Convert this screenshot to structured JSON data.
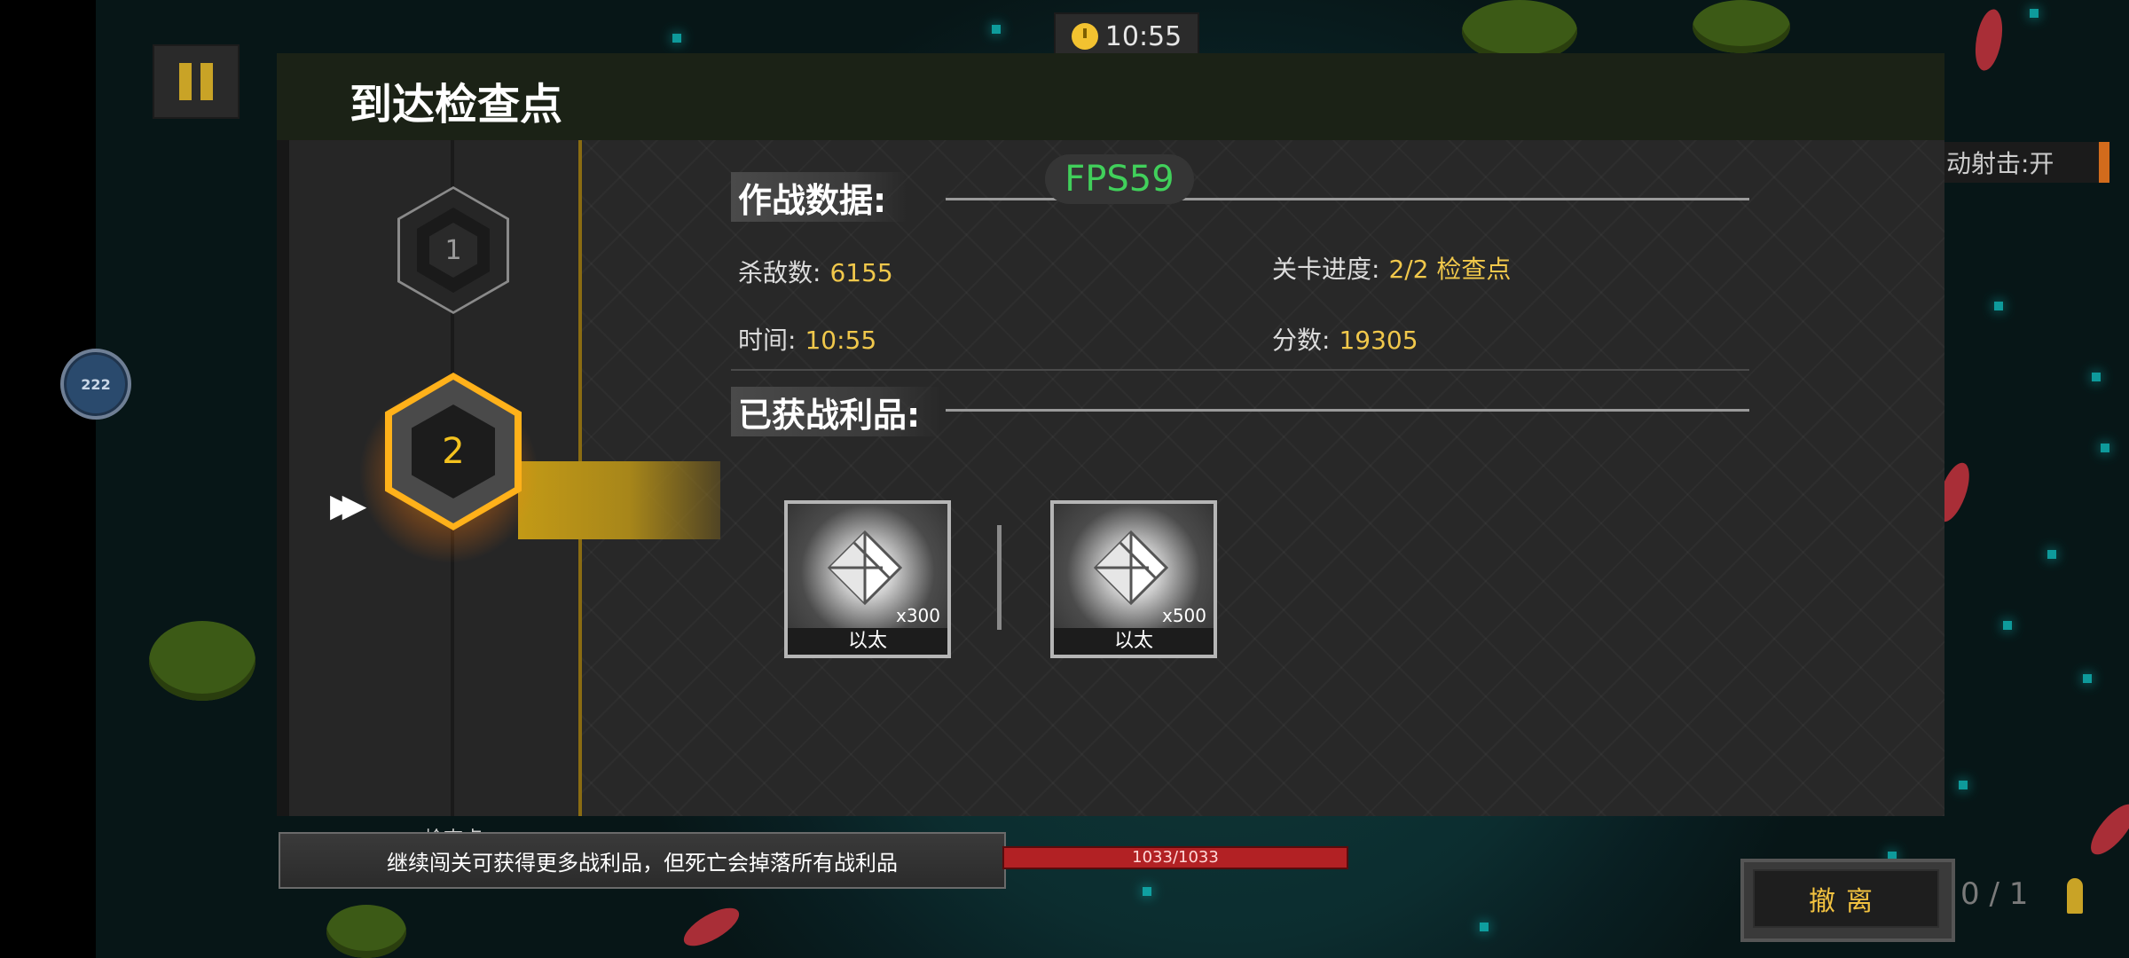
{
  "hud": {
    "timer": "10:55",
    "buff_label": "222",
    "auto_fire_label": "动射击:开",
    "fps": "FPS59",
    "hp": "1033/1033",
    "evacuate_label": "撤离",
    "ammo_current": "0",
    "ammo_sep": "/",
    "ammo_max": "1"
  },
  "dialog": {
    "title": "到达检查点",
    "checkpoints": [
      {
        "number": "1",
        "state": "completed"
      },
      {
        "number": "2",
        "state": "current"
      }
    ],
    "checkpoint_label": "检查点",
    "combat_data": {
      "heading": "作战数据:",
      "kills_label": "杀敌数:",
      "kills": "6155",
      "progress_label": "关卡进度:",
      "progress": "2/2 检查点",
      "time_label": "时间:",
      "time": "10:55",
      "score_label": "分数:",
      "score": "19305"
    },
    "loot": {
      "heading": "已获战利品:",
      "items": [
        {
          "name": "以太",
          "qty": "x300"
        },
        {
          "name": "以太",
          "qty": "x500"
        }
      ]
    }
  },
  "tip": "继续闯关可获得更多战利品，但死亡会掉落所有战利品",
  "colors": {
    "accent_gold": "#f2c240",
    "fps_green": "#41d05b",
    "hp_red": "#b22124",
    "dialog_bg": "#282828",
    "header_bg": "#1b2216"
  },
  "icons": [
    "pause-icon",
    "clock-icon",
    "double-arrow-icon",
    "ether-crystal-icon",
    "bullet-icon"
  ]
}
